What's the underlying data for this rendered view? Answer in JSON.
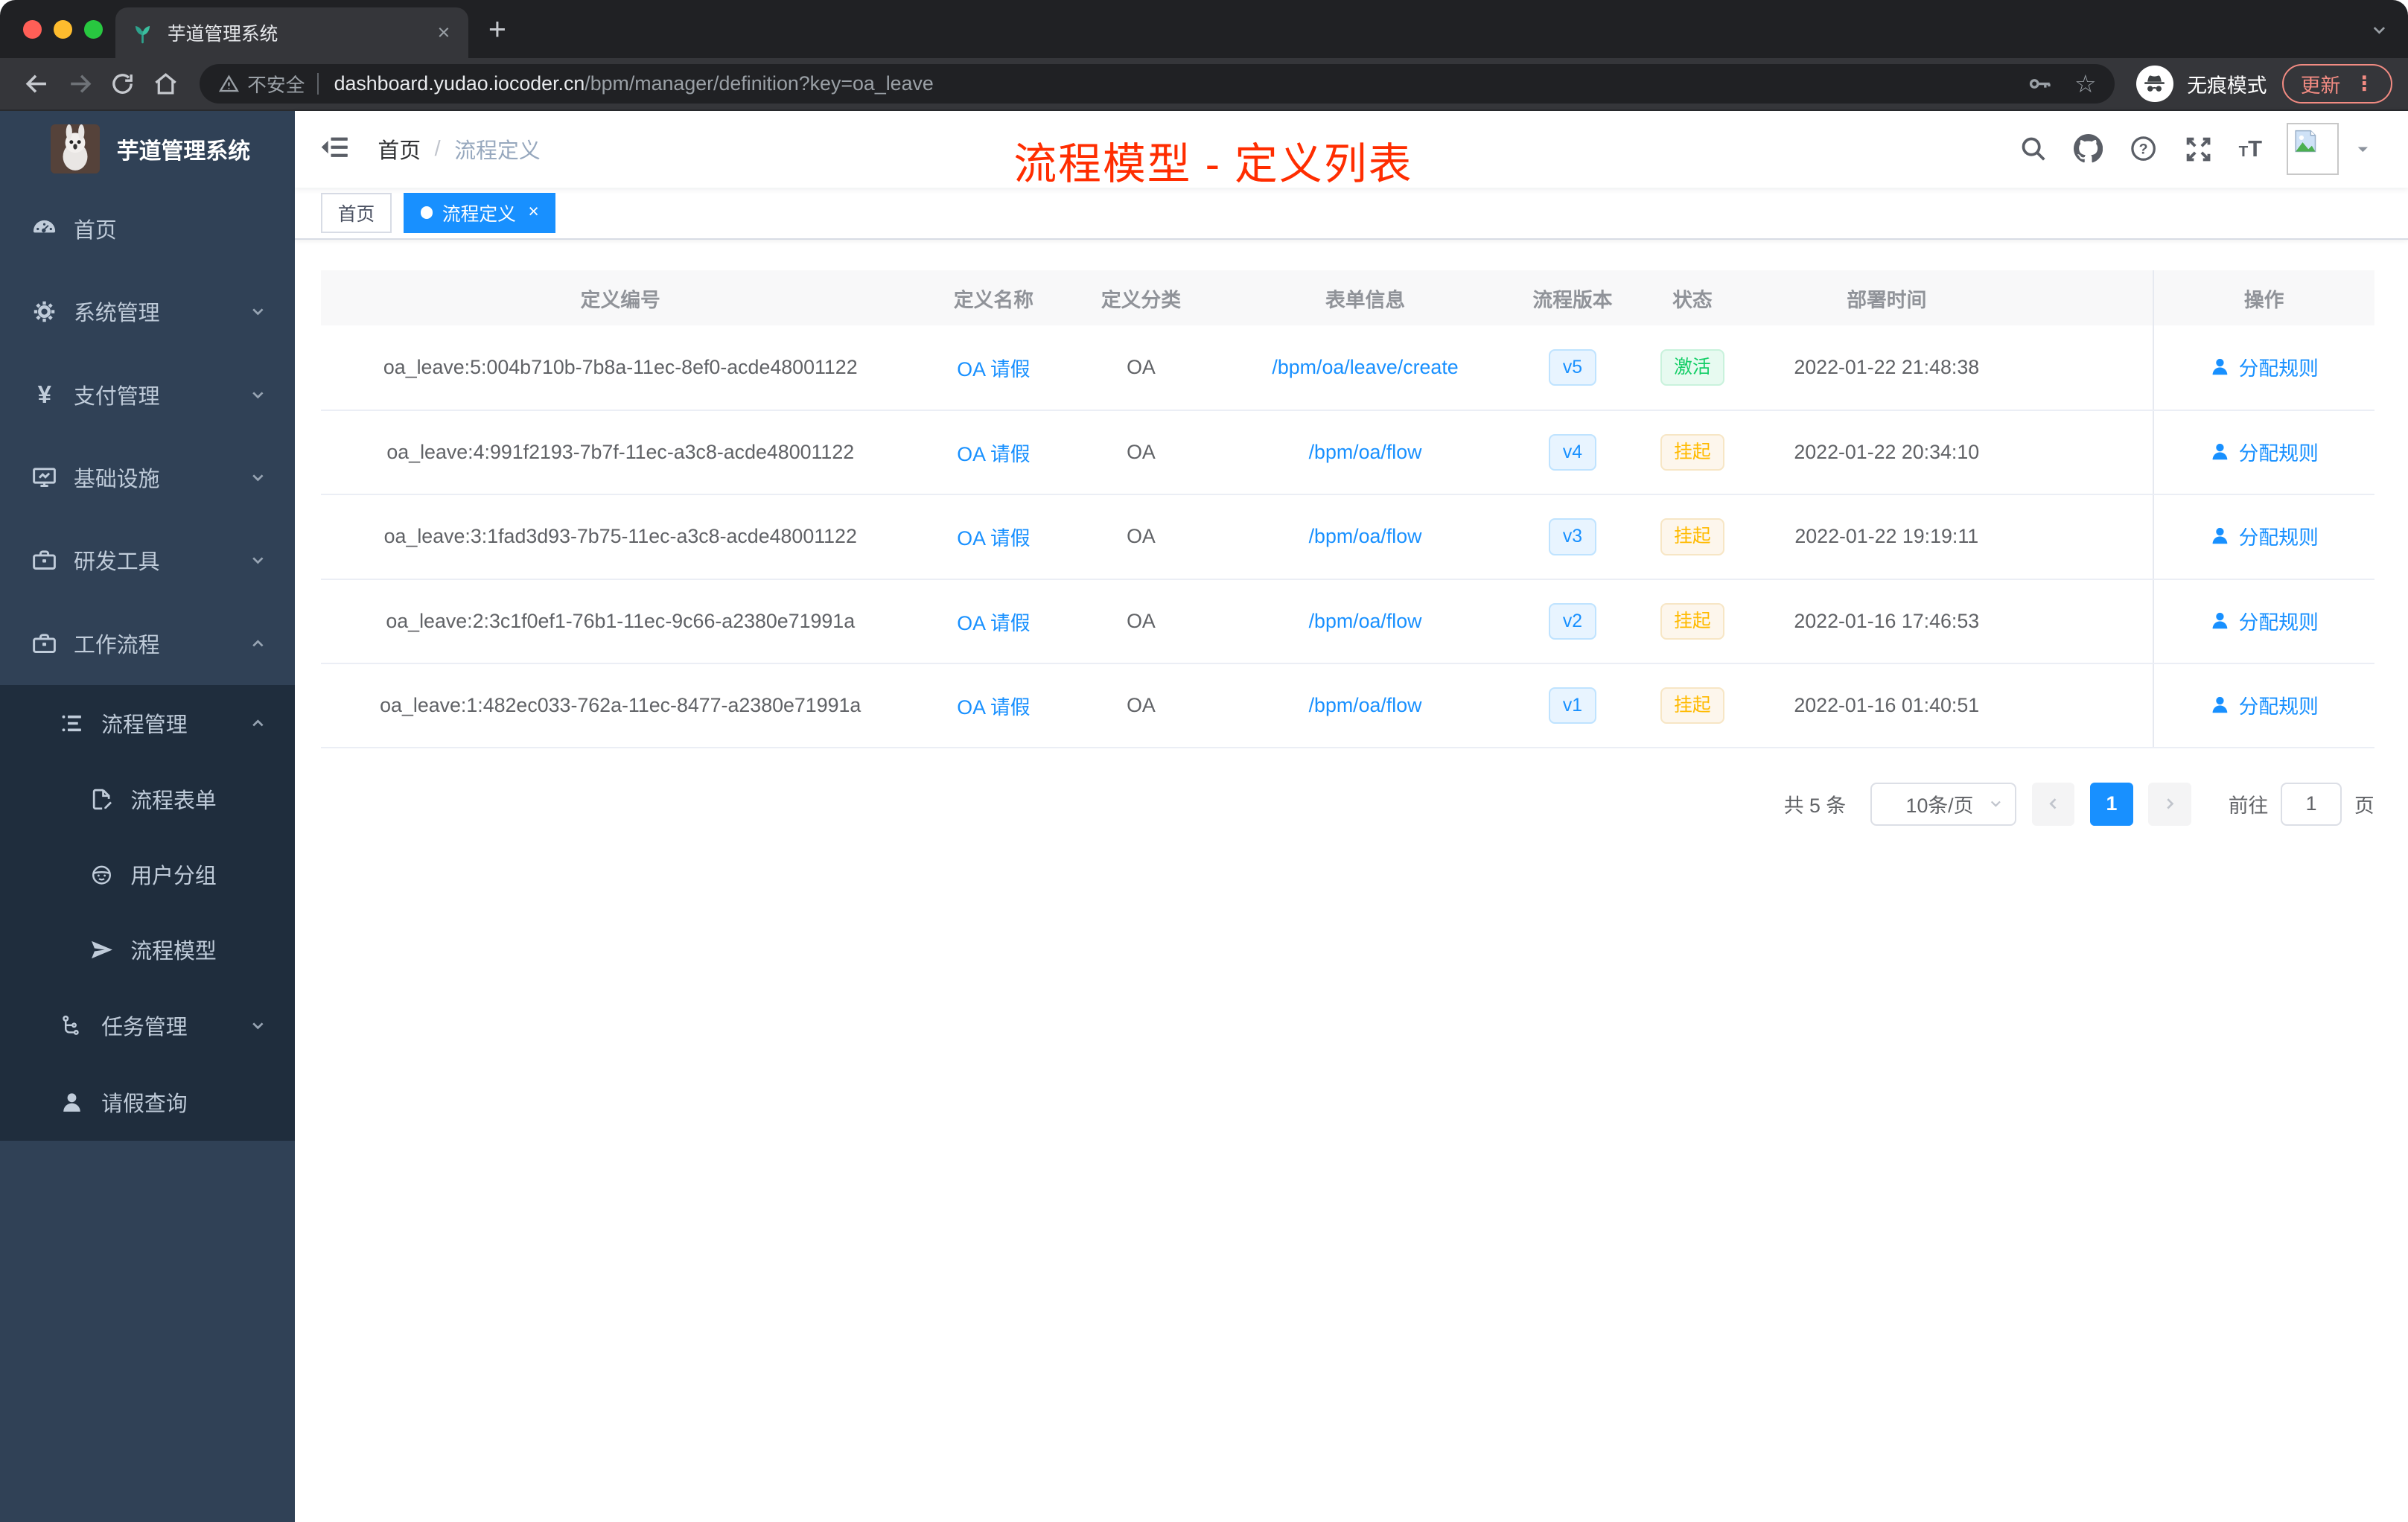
{
  "browser": {
    "tab_title": "芋道管理系统",
    "tab_close": "×",
    "new_tab": "+",
    "security_label": "不安全",
    "url_host": "dashboard.yudao.iocoder.cn",
    "url_path": "/bpm/manager/definition?key=oa_leave",
    "incognito_label": "无痕模式",
    "update_label": "更新",
    "menu_dots": "⋮"
  },
  "sidebar": {
    "logo_title": "芋道管理系统",
    "menu": [
      {
        "label": "首页",
        "icon": "dashboard-icon",
        "level": 1
      },
      {
        "label": "系统管理",
        "icon": "gear-icon",
        "level": 1,
        "chevron": "down"
      },
      {
        "label": "支付管理",
        "icon": "yen-icon",
        "level": 1,
        "chevron": "down"
      },
      {
        "label": "基础设施",
        "icon": "monitor-icon",
        "level": 1,
        "chevron": "down"
      },
      {
        "label": "研发工具",
        "icon": "toolbox-icon",
        "level": 1,
        "chevron": "down"
      },
      {
        "label": "工作流程",
        "icon": "briefcase-icon",
        "level": 1,
        "chevron": "up"
      },
      {
        "label": "流程管理",
        "icon": "list-icon",
        "level": 2,
        "chevron": "up"
      },
      {
        "label": "流程表单",
        "icon": "form-edit-icon",
        "level": 3
      },
      {
        "label": "用户分组",
        "icon": "robot-icon",
        "level": 3
      },
      {
        "label": "流程模型",
        "icon": "send-icon",
        "level": 3
      },
      {
        "label": "任务管理",
        "icon": "flow-icon",
        "level": 2,
        "chevron": "down"
      },
      {
        "label": "请假查询",
        "icon": "user-icon",
        "level": 2
      }
    ]
  },
  "topbar": {
    "breadcrumb_home": "首页",
    "breadcrumb_sep": "/",
    "breadcrumb_current": "流程定义",
    "overlay_title": "流程模型 - 定义列表",
    "icons": [
      "search-icon",
      "github-icon",
      "help-icon",
      "fullscreen-icon",
      "font-size-icon",
      "avatar"
    ]
  },
  "tags": {
    "home": "首页",
    "active": "流程定义",
    "active_close": "×"
  },
  "table": {
    "columns": [
      "定义编号",
      "定义名称",
      "定义分类",
      "表单信息",
      "流程版本",
      "状态",
      "部署时间",
      "操作"
    ],
    "action_label": "分配规则",
    "rows": [
      {
        "id": "oa_leave:5:004b710b-7b8a-11ec-8ef0-acde48001122",
        "name": "OA 请假",
        "category": "OA",
        "form": "/bpm/oa/leave/create",
        "version": "v5",
        "status": "激活",
        "status_type": "success",
        "time": "2022-01-22 21:48:38"
      },
      {
        "id": "oa_leave:4:991f2193-7b7f-11ec-a3c8-acde48001122",
        "name": "OA 请假",
        "category": "OA",
        "form": "/bpm/oa/flow",
        "version": "v4",
        "status": "挂起",
        "status_type": "warning",
        "time": "2022-01-22 20:34:10"
      },
      {
        "id": "oa_leave:3:1fad3d93-7b75-11ec-a3c8-acde48001122",
        "name": "OA 请假",
        "category": "OA",
        "form": "/bpm/oa/flow",
        "version": "v3",
        "status": "挂起",
        "status_type": "warning",
        "time": "2022-01-22 19:19:11"
      },
      {
        "id": "oa_leave:2:3c1f0ef1-76b1-11ec-9c66-a2380e71991a",
        "name": "OA 请假",
        "category": "OA",
        "form": "/bpm/oa/flow",
        "version": "v2",
        "status": "挂起",
        "status_type": "warning",
        "time": "2022-01-16 17:46:53"
      },
      {
        "id": "oa_leave:1:482ec033-762a-11ec-8477-a2380e71991a",
        "name": "OA 请假",
        "category": "OA",
        "form": "/bpm/oa/flow",
        "version": "v1",
        "status": "挂起",
        "status_type": "warning",
        "time": "2022-01-16 01:40:51"
      }
    ]
  },
  "pagination": {
    "total": "共 5 条",
    "page_size": "10条/页",
    "page": "1",
    "goto": "前往",
    "unit": "页"
  },
  "colors": {
    "accent": "#1890ff",
    "success": "#13ce66",
    "warning": "#ffba00",
    "overlay_red": "#ff2d00",
    "sidebar_bg": "#304156",
    "submenu_bg": "#1f2d3d"
  }
}
